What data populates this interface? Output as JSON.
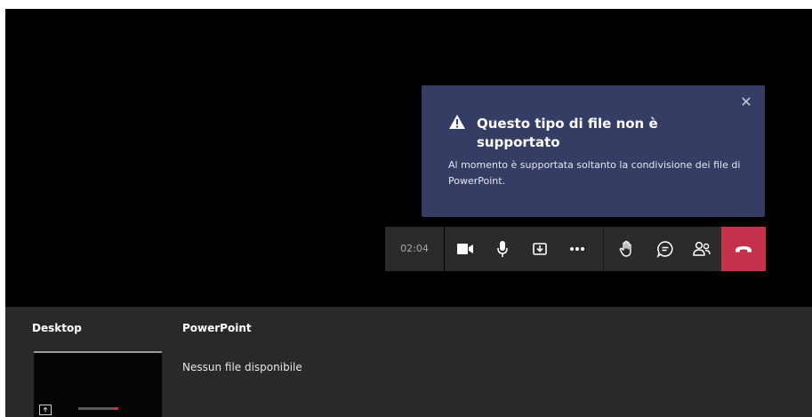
{
  "toast": {
    "title": "Questo tipo di file non è supportato",
    "body": "Al momento è supportata soltanto la condivisione dei file di PowerPoint.",
    "close_glyph": "✕",
    "icon": "warning-icon"
  },
  "call_bar": {
    "timer": "02:04",
    "buttons": [
      {
        "icon": "camera-icon"
      },
      {
        "icon": "microphone-icon"
      },
      {
        "icon": "share-tray-icon"
      },
      {
        "icon": "more-icon"
      },
      {
        "icon": "raise-hand-icon"
      },
      {
        "icon": "chat-icon"
      },
      {
        "icon": "participants-icon"
      },
      {
        "icon": "hang-up-icon"
      }
    ],
    "hangup_color": "#c4314b"
  },
  "tray": {
    "desktop_label": "Desktop",
    "powerpoint_label": "PowerPoint",
    "powerpoint_empty": "Nessun file disponibile"
  },
  "colors": {
    "toast_bg": "#363d65",
    "bar_bg": "#2b2b2b",
    "tray_bg": "#292929",
    "stage_bg": "#000000"
  }
}
